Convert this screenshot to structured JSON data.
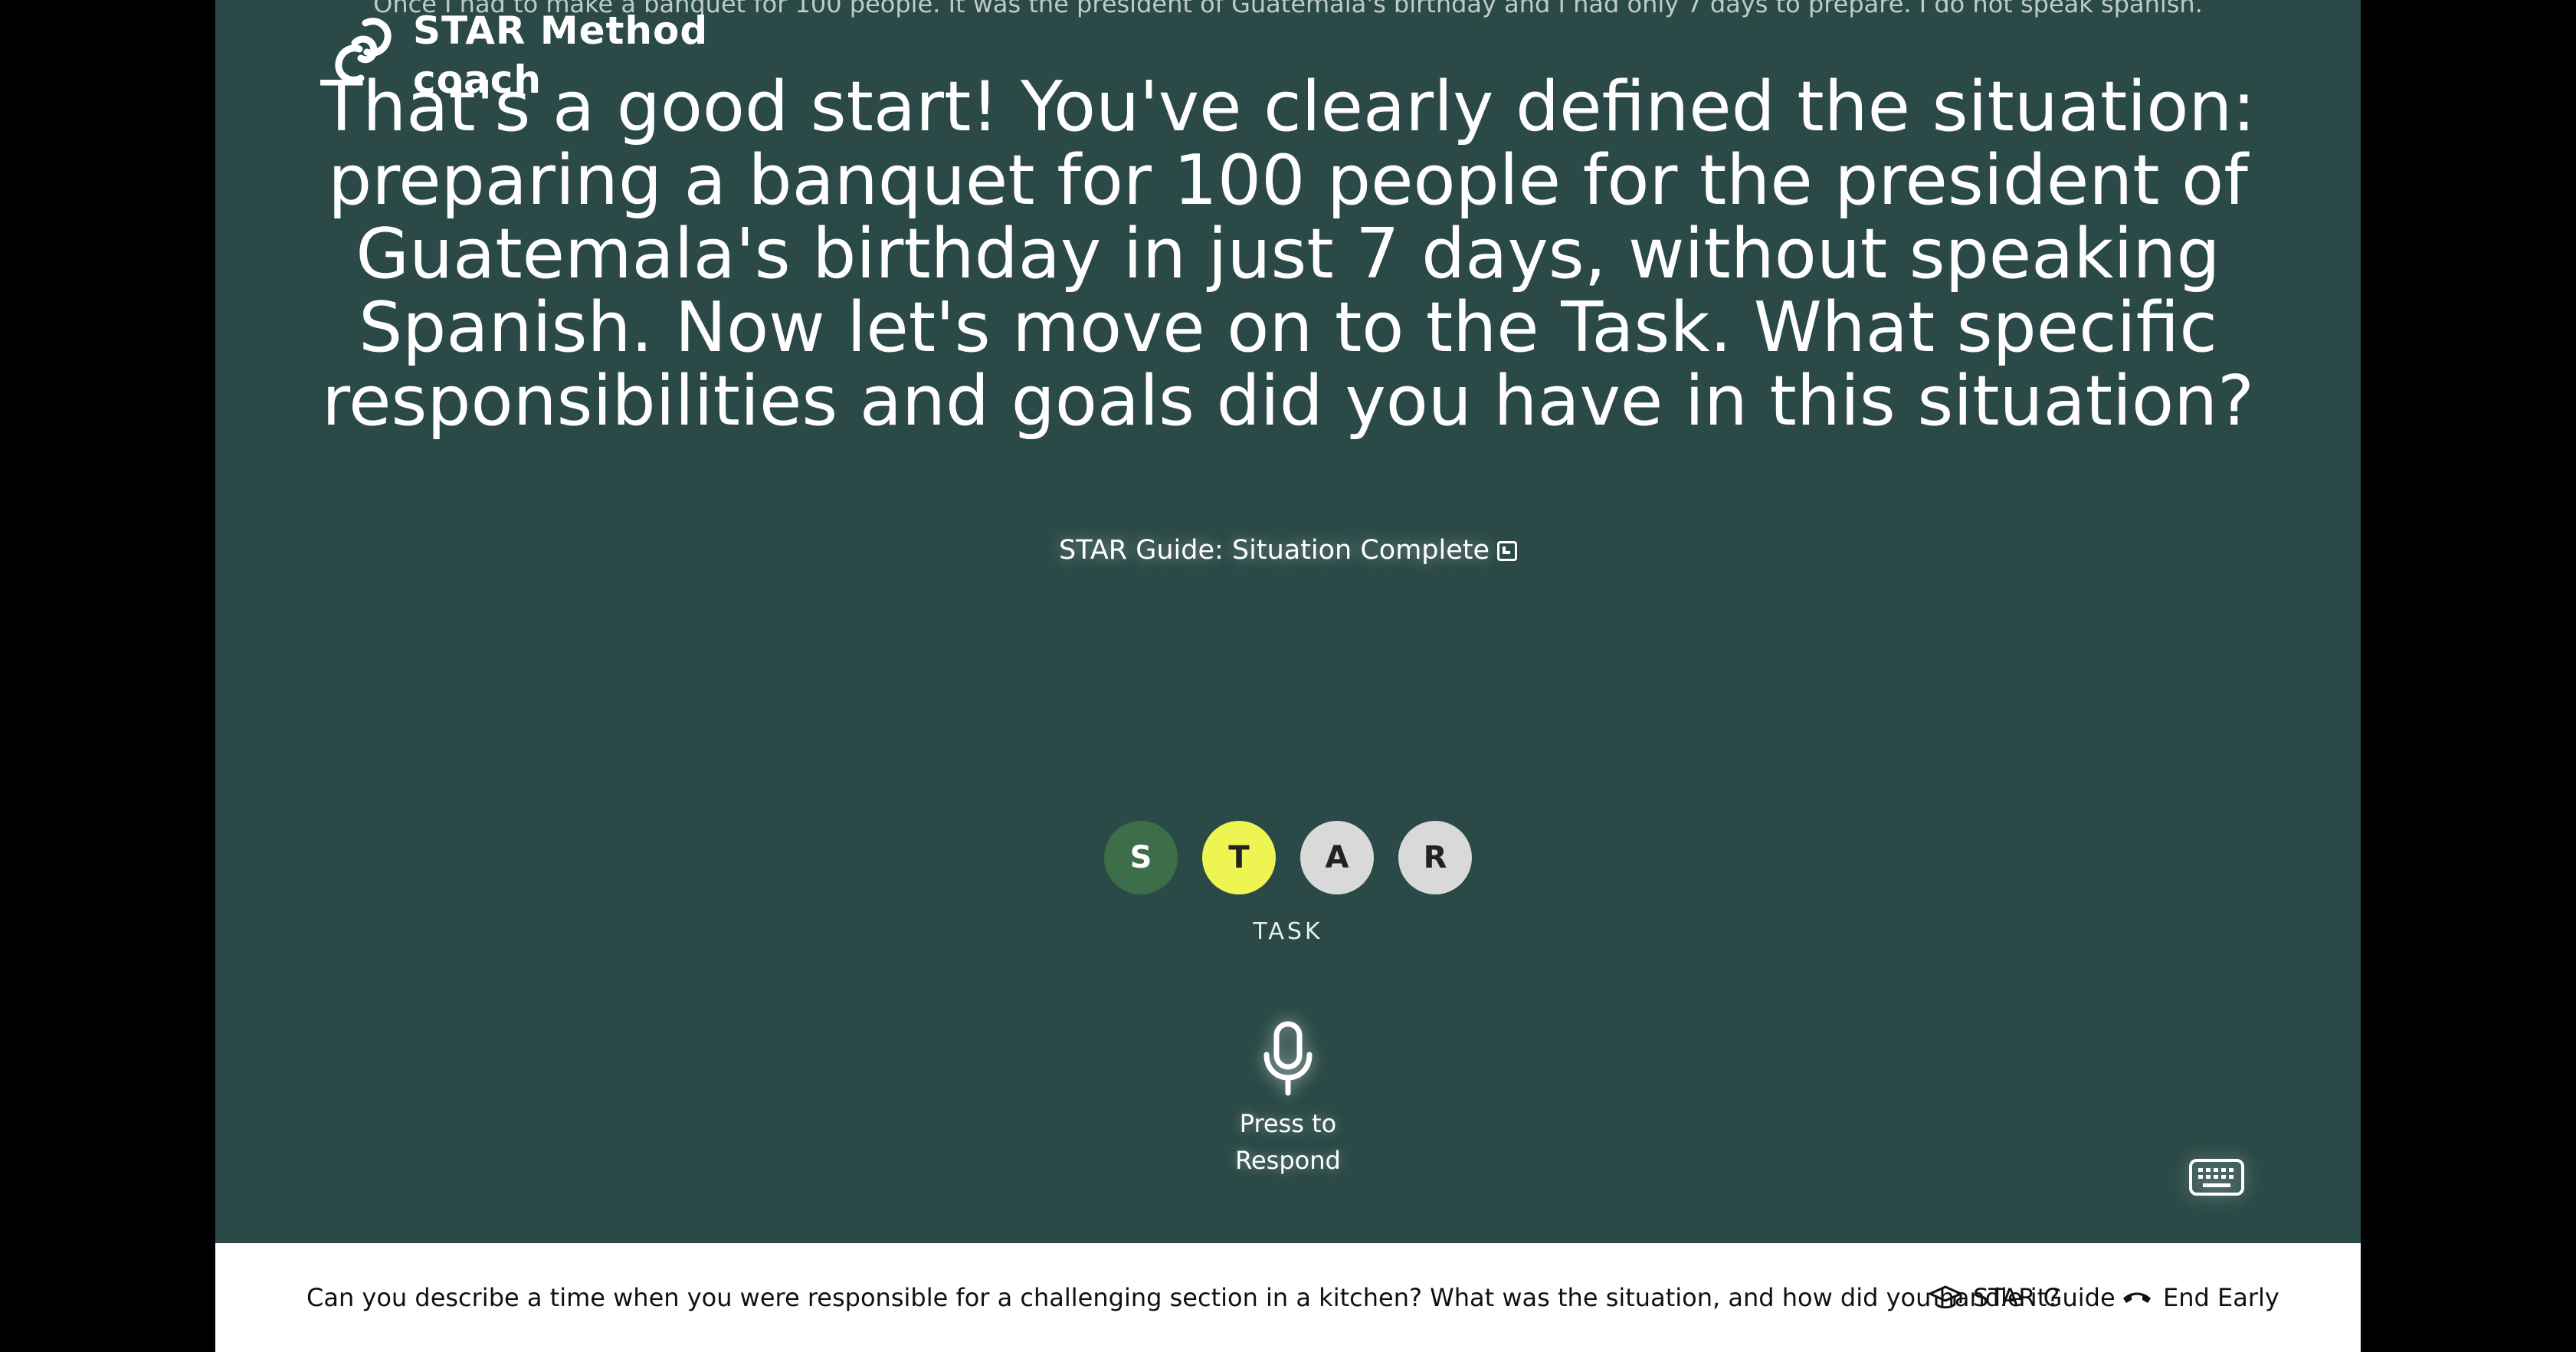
{
  "brand": {
    "name": "STAR Method coach"
  },
  "transcript": {
    "text": "Once I had to make a banquet for 100 people. It was the president of Guatemala's birthday and I had only 7 days to prepare. I do not speak spanish."
  },
  "coach_message": {
    "text": "That's a good start! You've clearly defined the situation: preparing a banquet for 100 people for the president of Guatemala's birthday in just 7 days, without speaking Spanish. Now let's move on to the Task. What specific responsibilities and goals did you have in this situation?"
  },
  "guide_link": {
    "label": "STAR Guide: Situation Complete",
    "icon": "external-link-icon"
  },
  "steps": [
    {
      "letter": "S",
      "state": "done",
      "color": "#3c6e4a"
    },
    {
      "letter": "T",
      "state": "active",
      "color": "#eef553"
    },
    {
      "letter": "A",
      "state": "pending",
      "color": "#d9d9d9"
    },
    {
      "letter": "R",
      "state": "pending",
      "color": "#d9d9d9"
    }
  ],
  "current_step_label": "TASK",
  "mic": {
    "label": "Press to Respond",
    "icon": "microphone-icon"
  },
  "keyboard": {
    "icon": "keyboard-icon"
  },
  "bottom_bar": {
    "question": "Can you describe a time when you were responsible for a challenging section in a kitchen? What was the situation, and how did you handle it?",
    "star_guide_label": "STAR Guide",
    "star_guide_icon": "graduation-cap-icon",
    "end_early_label": "End Early",
    "end_early_icon": "hang-up-phone-icon"
  },
  "colors": {
    "background": "#2b4a47",
    "bar": "#ffffff"
  }
}
